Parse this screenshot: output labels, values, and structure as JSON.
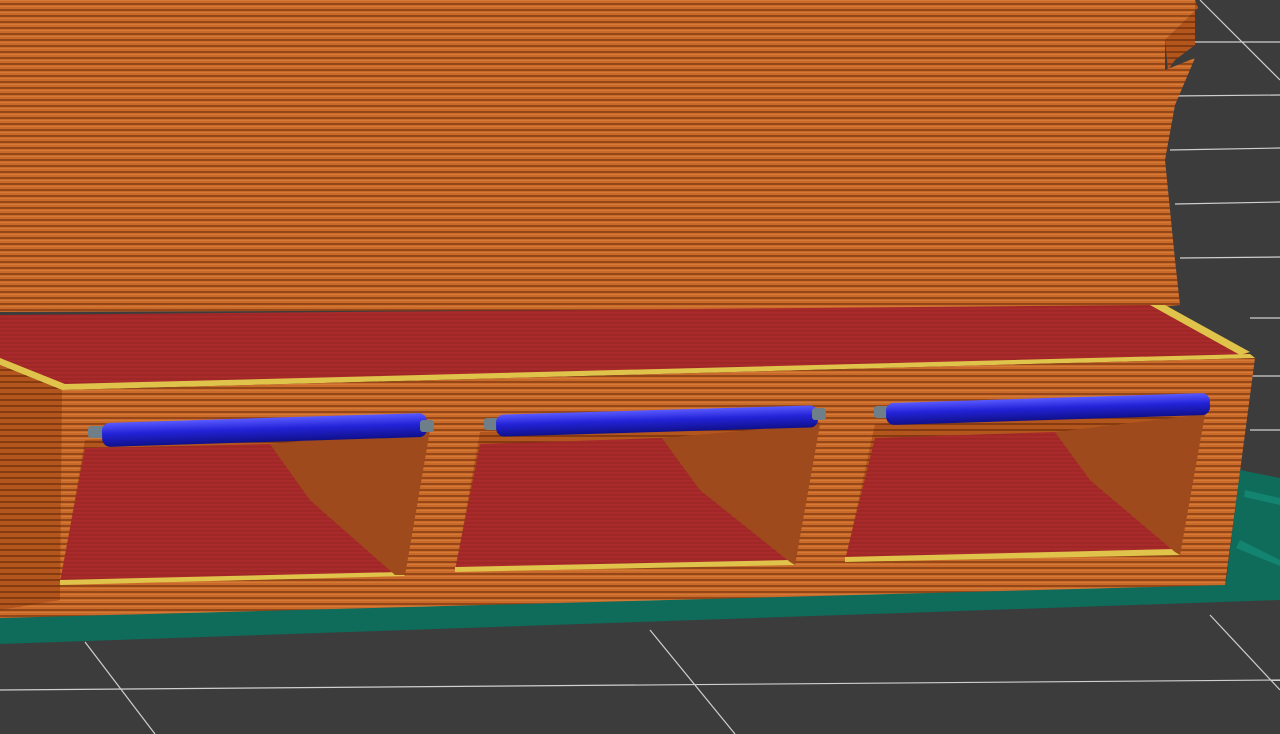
{
  "viewport": {
    "background": "#3c3c3c",
    "grid_line": "#cfcfcf"
  },
  "colors": {
    "perimeter": "#c96a2a",
    "perimeter_dark": "#a94f1a",
    "perimeter_line": "#8a3e12",
    "infill": "#a82a2a",
    "infill_line": "#8e2020",
    "overhang": "#e0c34a",
    "bridge": "#1f1fcc",
    "bridge_highlight": "#4a4aff",
    "skirt": "#0f6b5a",
    "wipe": "#6e7f8a"
  },
  "icons": {
    "scene": "sliced-print-preview"
  }
}
